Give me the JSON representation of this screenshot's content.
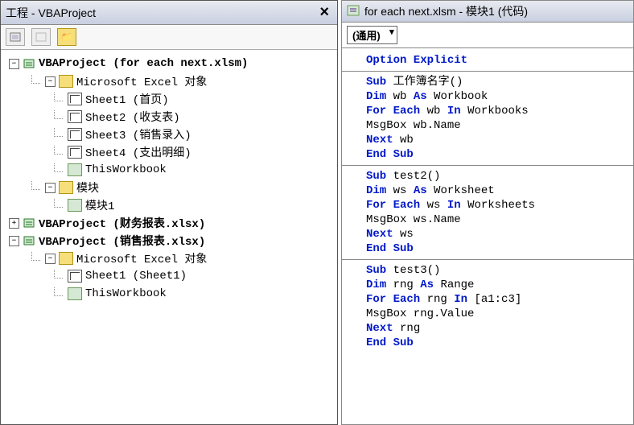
{
  "leftPane": {
    "title": "工程 - VBAProject",
    "tree": [
      {
        "indent": 0,
        "exp": "−",
        "icon": "proj",
        "label": "VBAProject (for each next.xlsm)",
        "bold": true
      },
      {
        "indent": 1,
        "exp": "−",
        "icon": "folder",
        "label": "Microsoft Excel 对象"
      },
      {
        "indent": 2,
        "icon": "sheet",
        "label": "Sheet1 (首页)"
      },
      {
        "indent": 2,
        "icon": "sheet",
        "label": "Sheet2 (收支表)"
      },
      {
        "indent": 2,
        "icon": "sheet",
        "label": "Sheet3 (销售录入)"
      },
      {
        "indent": 2,
        "icon": "sheet",
        "label": "Sheet4 (支出明细)"
      },
      {
        "indent": 2,
        "icon": "module",
        "label": "ThisWorkbook"
      },
      {
        "indent": 1,
        "exp": "−",
        "icon": "folder",
        "label": "模块"
      },
      {
        "indent": 2,
        "icon": "module",
        "label": "模块1"
      },
      {
        "indent": 0,
        "exp": "+",
        "icon": "proj",
        "label": "VBAProject (财务报表.xlsx)",
        "bold": true
      },
      {
        "indent": 0,
        "exp": "−",
        "icon": "proj",
        "label": "VBAProject (销售报表.xlsx)",
        "bold": true
      },
      {
        "indent": 1,
        "exp": "−",
        "icon": "folder",
        "label": "Microsoft Excel 对象"
      },
      {
        "indent": 2,
        "icon": "sheet",
        "label": "Sheet1 (Sheet1)"
      },
      {
        "indent": 2,
        "icon": "module",
        "label": "ThisWorkbook"
      }
    ]
  },
  "rightPane": {
    "title": "for each next.xlsm - 模块1 (代码)",
    "combo": "(通用)",
    "block1": [
      {
        "t": "Option Explicit",
        "kw": true
      }
    ],
    "block2": [
      {
        "seg": [
          {
            "t": "Sub ",
            "kw": true
          },
          {
            "t": "工作簿名字()"
          }
        ]
      },
      {
        "seg": [
          {
            "t": "Dim ",
            "kw": true
          },
          {
            "t": "wb "
          },
          {
            "t": "As ",
            "kw": true
          },
          {
            "t": "Workbook"
          }
        ]
      },
      {
        "seg": [
          {
            "t": "For Each ",
            "kw": true
          },
          {
            "t": "wb "
          },
          {
            "t": "In ",
            "kw": true
          },
          {
            "t": "Workbooks"
          }
        ]
      },
      {
        "seg": [
          {
            "t": "MsgBox wb.Name"
          }
        ]
      },
      {
        "seg": [
          {
            "t": "Next ",
            "kw": true
          },
          {
            "t": "wb"
          }
        ]
      },
      {
        "seg": [
          {
            "t": "End Sub",
            "kw": true
          }
        ]
      }
    ],
    "block3": [
      {
        "seg": [
          {
            "t": "Sub ",
            "kw": true
          },
          {
            "t": "test2()"
          }
        ]
      },
      {
        "seg": [
          {
            "t": "Dim ",
            "kw": true
          },
          {
            "t": "ws "
          },
          {
            "t": "As ",
            "kw": true
          },
          {
            "t": "Worksheet"
          }
        ]
      },
      {
        "seg": [
          {
            "t": "For Each ",
            "kw": true
          },
          {
            "t": "ws "
          },
          {
            "t": "In ",
            "kw": true
          },
          {
            "t": "Worksheets"
          }
        ]
      },
      {
        "seg": [
          {
            "t": "MsgBox ws.Name"
          }
        ]
      },
      {
        "seg": [
          {
            "t": "Next ",
            "kw": true
          },
          {
            "t": "ws"
          }
        ]
      },
      {
        "seg": [
          {
            "t": "End Sub",
            "kw": true
          }
        ]
      }
    ],
    "block4": [
      {
        "seg": [
          {
            "t": "Sub ",
            "kw": true
          },
          {
            "t": "test3()"
          }
        ]
      },
      {
        "seg": [
          {
            "t": "Dim ",
            "kw": true
          },
          {
            "t": "rng "
          },
          {
            "t": "As ",
            "kw": true
          },
          {
            "t": "Range"
          }
        ]
      },
      {
        "seg": [
          {
            "t": "For Each ",
            "kw": true
          },
          {
            "t": "rng "
          },
          {
            "t": "In ",
            "kw": true
          },
          {
            "t": "[a1:c3]"
          }
        ]
      },
      {
        "seg": [
          {
            "t": "MsgBox rng.Value"
          }
        ]
      },
      {
        "seg": [
          {
            "t": "Next ",
            "kw": true
          },
          {
            "t": "rng"
          }
        ]
      },
      {
        "seg": [
          {
            "t": "End Sub",
            "kw": true
          }
        ]
      }
    ]
  }
}
